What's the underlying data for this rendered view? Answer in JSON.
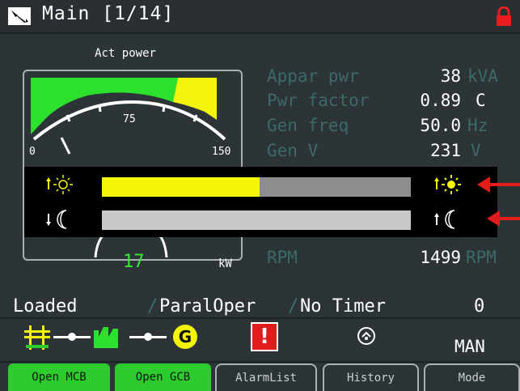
{
  "header": {
    "title": "Main [1/14]",
    "icons": [
      "screen-icon",
      "lock-icon"
    ],
    "lock_color": "#e51e1e"
  },
  "gauge": {
    "title": "Act power",
    "min_label": "0",
    "mid_label": "75",
    "max_label": "150",
    "value": "17",
    "unit": "kW",
    "needle_value": 17,
    "zones": [
      "green",
      "yellow"
    ]
  },
  "measurements": [
    {
      "label": "Appar pwr",
      "value": "38",
      "unit": "kVA"
    },
    {
      "label": "Pwr factor",
      "value": "0.89",
      "unit": "C"
    },
    {
      "label": "Gen freq",
      "value": "50.0",
      "unit": "Hz"
    },
    {
      "label": "Gen V",
      "value": "231",
      "unit": "V"
    },
    {
      "label": "RPM",
      "value": "1499",
      "unit": "RPM"
    }
  ],
  "brightness": {
    "day_level": 0.51,
    "night_level": 1.0,
    "day_color": "#f5f50a",
    "night_color": "#c8c8c8",
    "icons": [
      "sun-up-icon",
      "moon-down-icon",
      "sun-right-icon",
      "moon-right-icon"
    ]
  },
  "status": {
    "state": "Loaded",
    "mode": "ParalOper",
    "timer": "No Timer",
    "count": "0"
  },
  "symbols": {
    "mode_label": "MAN",
    "icons": [
      "mains-icon",
      "mcb-icon",
      "load-icon",
      "gcb-icon",
      "generator-icon",
      "alarm-icon",
      "history-icon"
    ],
    "generator_letter": "G",
    "alarm_glyph": "!"
  },
  "softkeys": [
    "Open MCB",
    "Open GCB",
    "AlarmList",
    "History",
    "Mode"
  ],
  "colors": {
    "background": "#2d3437",
    "accent_green": "#2ecb2e",
    "alarm_red": "#e21b1b"
  }
}
